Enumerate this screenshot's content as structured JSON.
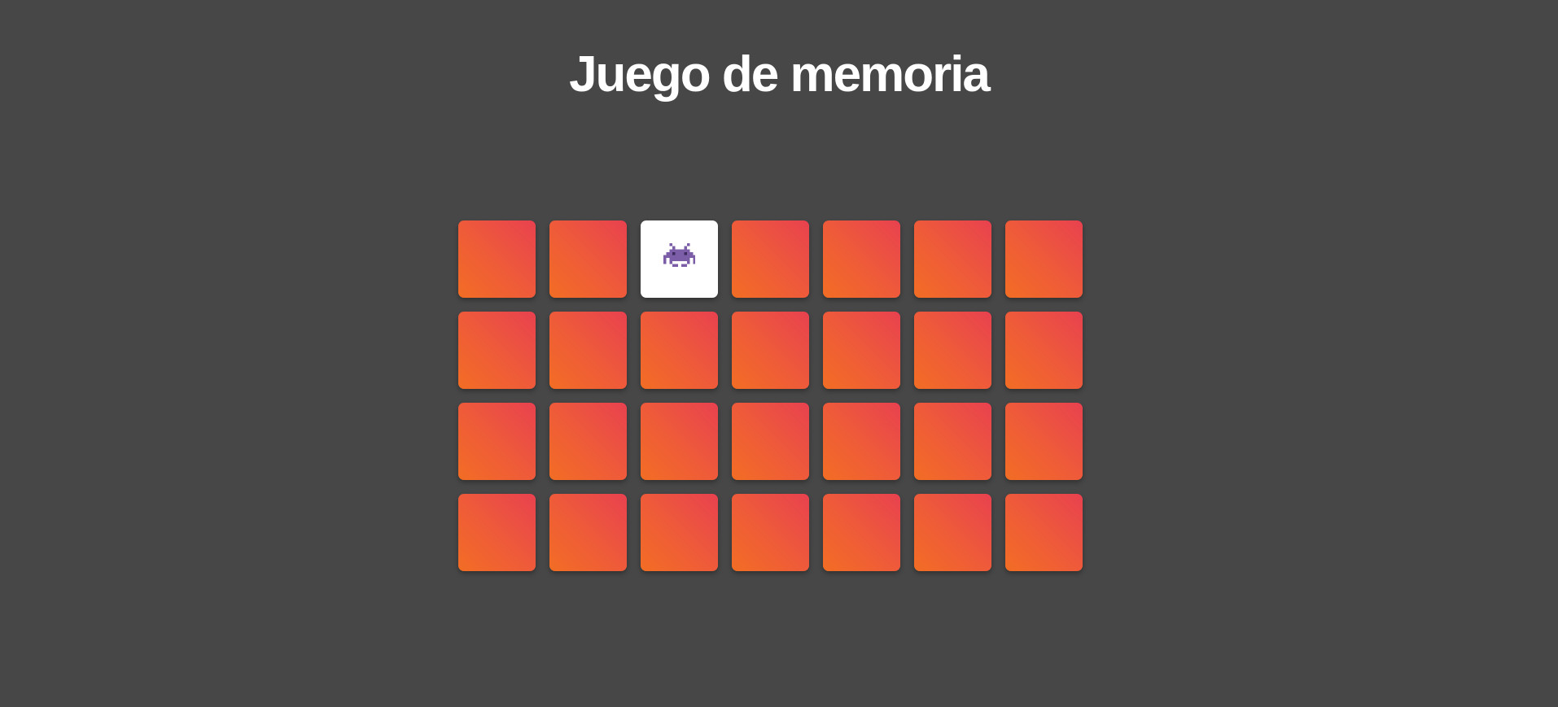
{
  "title": "Juego de memoria",
  "board": {
    "rows": 4,
    "columns": 7,
    "back_color_start": "#f36d24",
    "back_color_end": "#e8414f",
    "revealed_color": "#ffffff",
    "cards": [
      {
        "state": "hidden"
      },
      {
        "state": "hidden"
      },
      {
        "state": "revealed",
        "icon": "alien-monster-icon"
      },
      {
        "state": "hidden"
      },
      {
        "state": "hidden"
      },
      {
        "state": "hidden"
      },
      {
        "state": "hidden"
      },
      {
        "state": "hidden"
      },
      {
        "state": "hidden"
      },
      {
        "state": "hidden"
      },
      {
        "state": "hidden"
      },
      {
        "state": "hidden"
      },
      {
        "state": "hidden"
      },
      {
        "state": "hidden"
      },
      {
        "state": "hidden"
      },
      {
        "state": "hidden"
      },
      {
        "state": "hidden"
      },
      {
        "state": "hidden"
      },
      {
        "state": "hidden"
      },
      {
        "state": "hidden"
      },
      {
        "state": "hidden"
      },
      {
        "state": "hidden"
      },
      {
        "state": "hidden"
      },
      {
        "state": "hidden"
      },
      {
        "state": "hidden"
      },
      {
        "state": "hidden"
      },
      {
        "state": "hidden"
      },
      {
        "state": "hidden"
      }
    ]
  },
  "colors": {
    "background": "#474747",
    "title": "#ffffff",
    "alien": "#7b5ea7"
  }
}
